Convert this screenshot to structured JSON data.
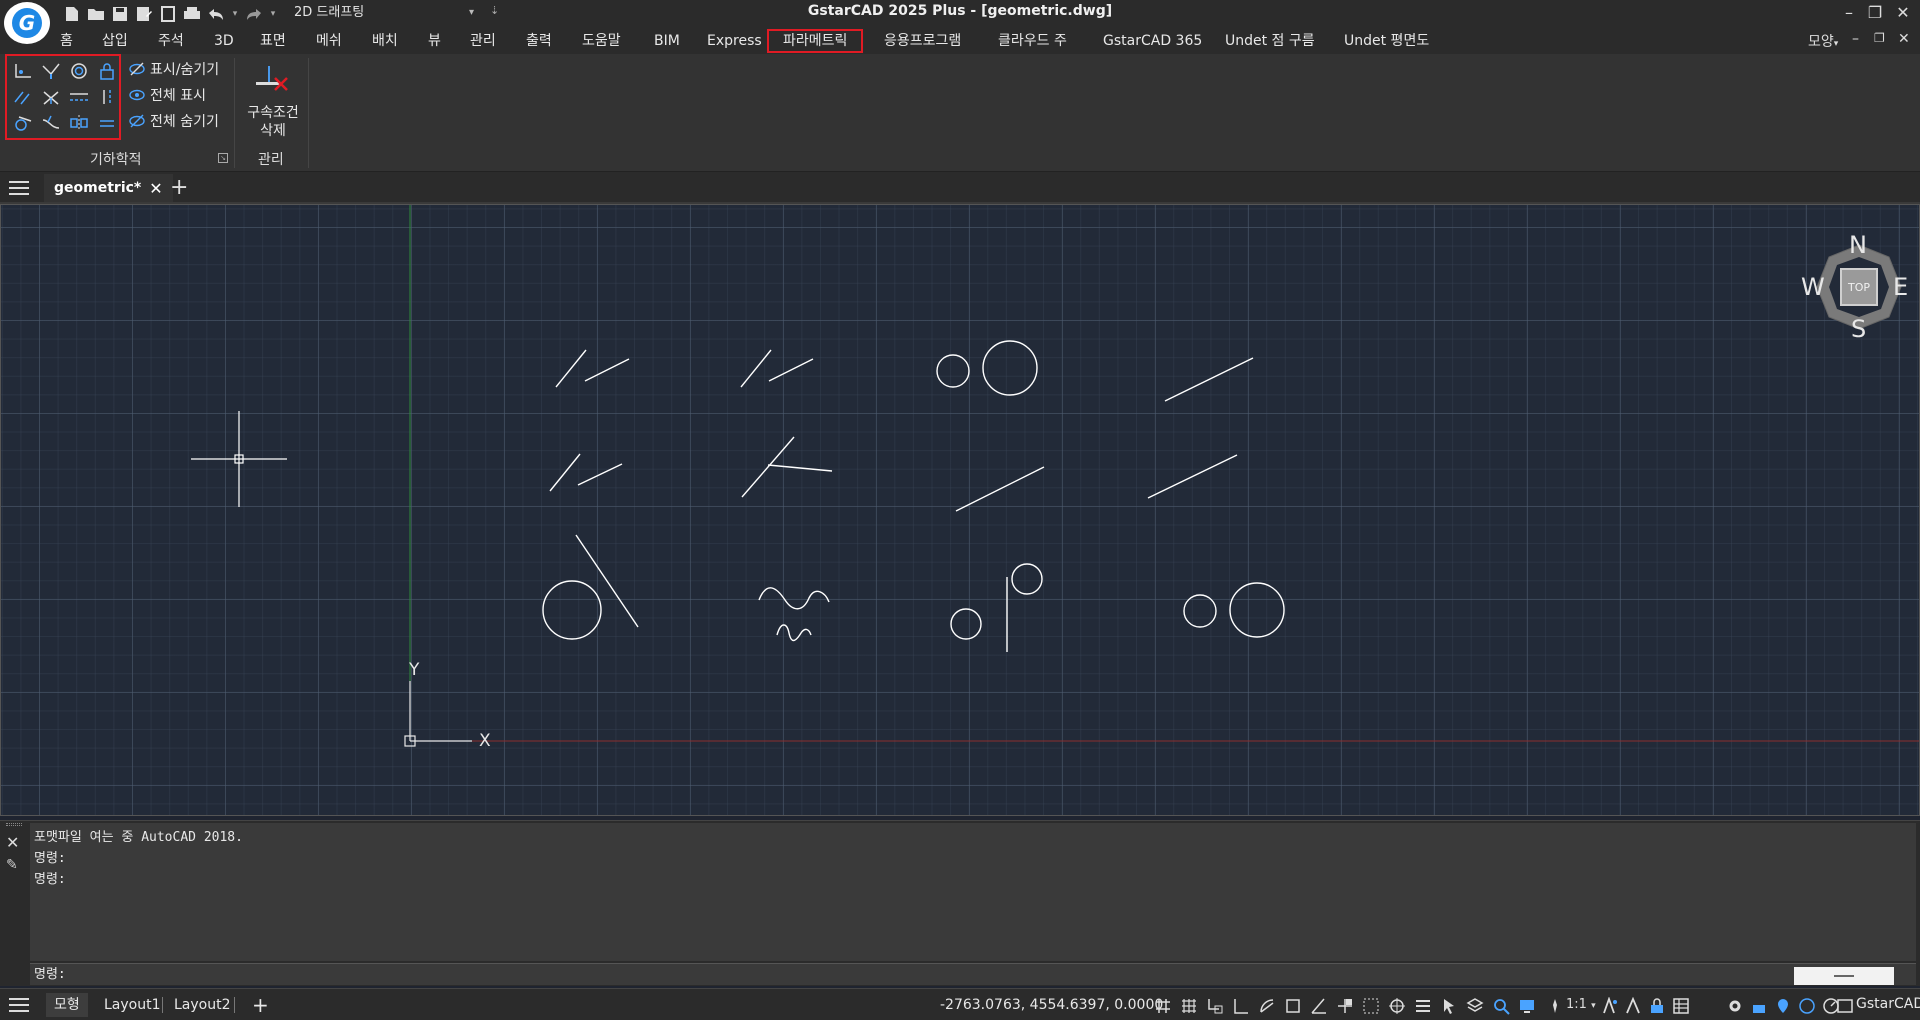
{
  "titlebar": {
    "title": "GstarCAD 2025 Plus - [geometric.dwg]",
    "workspace": "2D 드래프팅",
    "logo_text": "G"
  },
  "menubar": {
    "items": [
      "홈",
      "삽입",
      "주석",
      "3D",
      "표면",
      "메쉬",
      "배치",
      "뷰",
      "관리",
      "출력",
      "도움말",
      "BIM",
      "Express",
      "파라메트릭",
      "응용프로그램",
      "클라우드 주",
      "GstarCAD 365",
      "Undet 점 구름",
      "Undet 평면도"
    ],
    "active": "파라메트릭",
    "right_label": "모양"
  },
  "ribbon": {
    "show_hide": "표시/숨기기",
    "show_all": "전체 표시",
    "hide_all": "전체 숨기기",
    "geometric_panel": "기하학적",
    "delete_constraint": "구속조건",
    "delete_constraint_2": "삭제",
    "manage_panel": "관리"
  },
  "doctab": {
    "name": "geometric*"
  },
  "viewcube": {
    "north": "N",
    "south": "S",
    "east": "E",
    "west": "W",
    "top": "TOP"
  },
  "ucs": {
    "x_label": "X",
    "y_label": "Y"
  },
  "command": {
    "history": [
      "포맷파일 여는 중 AutoCAD 2018.",
      "명령:",
      "명령:"
    ],
    "prompt": "명령:"
  },
  "statusbar": {
    "model_tab": "모형",
    "layout1": "Layout1",
    "layout2": "Layout2",
    "coordinates": "-2763.0763, 4554.6397, 0.0000",
    "scale": "1:1",
    "brand": "GstarCAD"
  },
  "colors": {
    "highlight": "#e01b24",
    "canvas_bg": "#222a38",
    "y_axis": "#2e8b3a",
    "x_axis": "#8b2e2e"
  }
}
